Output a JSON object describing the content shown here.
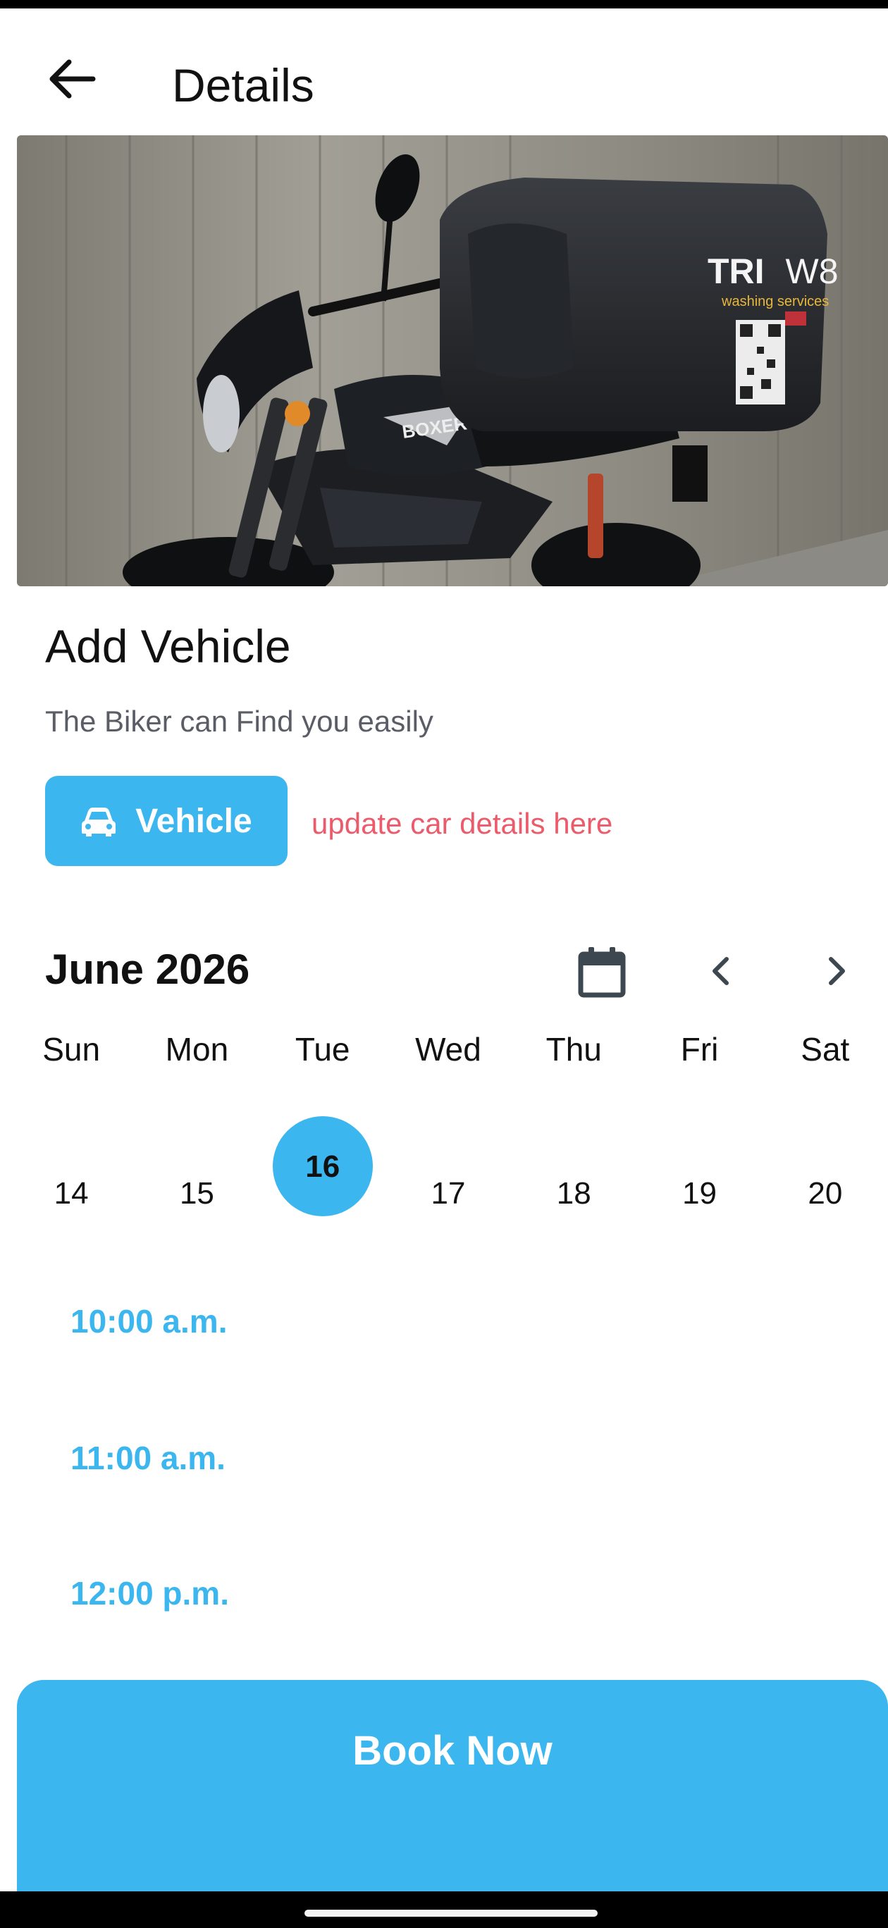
{
  "header": {
    "title": "Details",
    "back_icon": "arrow-left-icon"
  },
  "hero": {
    "box_brand": "TRI",
    "box_brand_suffix": "W8",
    "box_tagline": "washing services",
    "tank_badge": "BOXER"
  },
  "vehicle_section": {
    "title": "Add Vehicle",
    "subtitle": "The Biker can Find you easily",
    "button_label": "Vehicle",
    "button_icon": "car-icon",
    "hint": "update car details here"
  },
  "calendar": {
    "month_label": "June 2026",
    "weekdays": [
      "Sun",
      "Mon",
      "Tue",
      "Wed",
      "Thu",
      "Fri",
      "Sat"
    ],
    "days": [
      "14",
      "15",
      "16",
      "17",
      "18",
      "19",
      "20"
    ],
    "selected_day": "16"
  },
  "time_slots": [
    "10:00 a.m.",
    "11:00 a.m.",
    "12:00 p.m."
  ],
  "book_button": {
    "label": "Book Now"
  },
  "colors": {
    "accent": "#3bb6ee",
    "hint": "#ec5b6b",
    "text": "#111111",
    "muted": "#5b5d66"
  }
}
